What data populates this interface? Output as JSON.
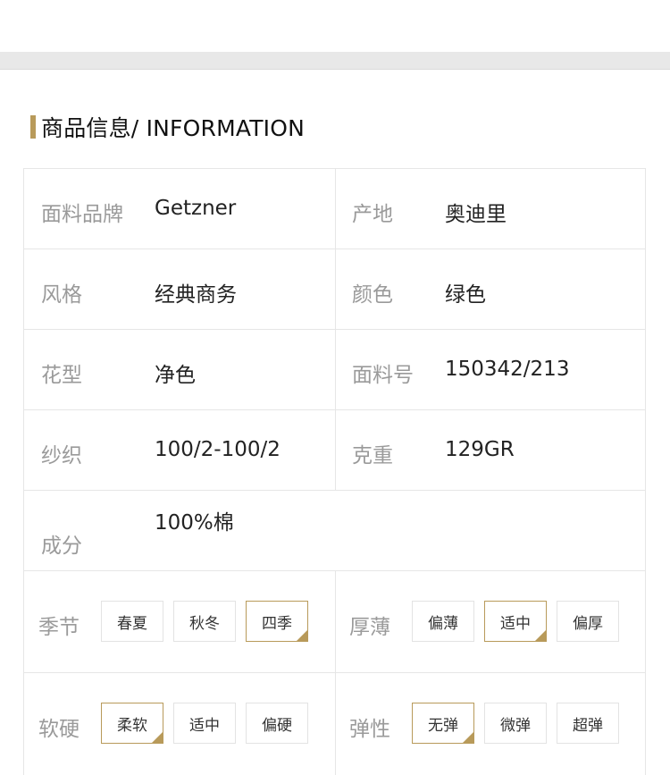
{
  "section": {
    "title": "商品信息/ INFORMATION"
  },
  "info_rows": [
    {
      "left_label": "面料品牌",
      "left_value": "Getzner",
      "right_label": "产地",
      "right_value": "奥迪里"
    },
    {
      "left_label": "风格",
      "left_value": "经典商务",
      "right_label": "颜色",
      "right_value": "绿色"
    },
    {
      "left_label": "花型",
      "left_value": "净色",
      "right_label": "面料号",
      "right_value": "150342/213"
    },
    {
      "left_label": "纱织",
      "left_value": "100/2-100/2",
      "right_label": "克重",
      "right_value": "129GR"
    }
  ],
  "composition": {
    "label": "成分",
    "value": "100%棉"
  },
  "options": {
    "season": {
      "label": "季节",
      "items": [
        "春夏",
        "秋冬",
        "四季"
      ],
      "selected": "四季"
    },
    "thickness": {
      "label": "厚薄",
      "items": [
        "偏薄",
        "适中",
        "偏厚"
      ],
      "selected": "适中"
    },
    "hardness": {
      "label": "软硬",
      "items": [
        "柔软",
        "适中",
        "偏硬"
      ],
      "selected": "柔软"
    },
    "elasticity": {
      "label": "弹性",
      "items": [
        "无弹",
        "微弹",
        "超弹"
      ],
      "selected": "无弹"
    }
  },
  "colors": {
    "accent": "#b89a5a",
    "border": "#e6e6e6",
    "label": "#9a9a9a"
  }
}
